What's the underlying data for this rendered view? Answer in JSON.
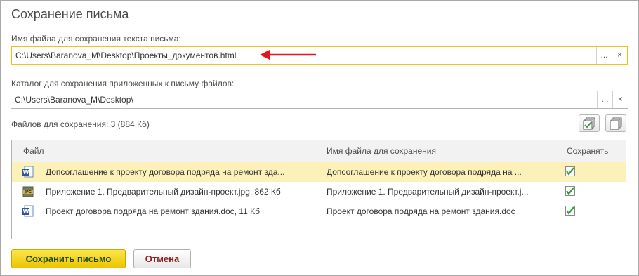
{
  "window": {
    "title": "Сохранение письма"
  },
  "file_field": {
    "label": "Имя файла для сохранения текста письма:",
    "value": "C:\\Users\\Baranova_M\\Desktop\\Проекты_документов.html",
    "select_button": "...",
    "clear_button": "×"
  },
  "dir_field": {
    "label": "Каталог для сохранения приложенных к письму файлов:",
    "value": "C:\\Users\\Baranova_M\\Desktop\\",
    "select_button": "...",
    "clear_button": "×"
  },
  "files_count": "Файлов для сохранения: 3 (884 Кб)",
  "table": {
    "columns": [
      "Файл",
      "Имя файла для сохранения",
      "Сохранять"
    ],
    "rows": [
      {
        "file": "Допсоглашение к проекту договора подряда на ремонт зда...",
        "save_name": "Допсоглашение к проекту договора подряда на ...",
        "icon": "word-doc-icon",
        "save": true,
        "selected": true
      },
      {
        "file": "Приложение 1. Предварительный дизайн-проект.jpg, 862 Кб",
        "save_name": "Приложение 1. Предварительный дизайн-проект.j...",
        "icon": "jpg-file-icon",
        "save": true,
        "selected": false
      },
      {
        "file": "Проект договора подряда на ремонт здания.doc, 11 Кб",
        "save_name": "Проект договора подряда на ремонт здания.doc",
        "icon": "word-doc-icon",
        "save": true,
        "selected": false
      }
    ]
  },
  "buttons": {
    "save": "Сохранить письмо",
    "cancel": "Отмена"
  },
  "colors": {
    "accent": "#f1c40f",
    "selected_row": "#fbf1b9",
    "annotation_arrow": "#e8141c",
    "check": "#2e9e2e"
  }
}
